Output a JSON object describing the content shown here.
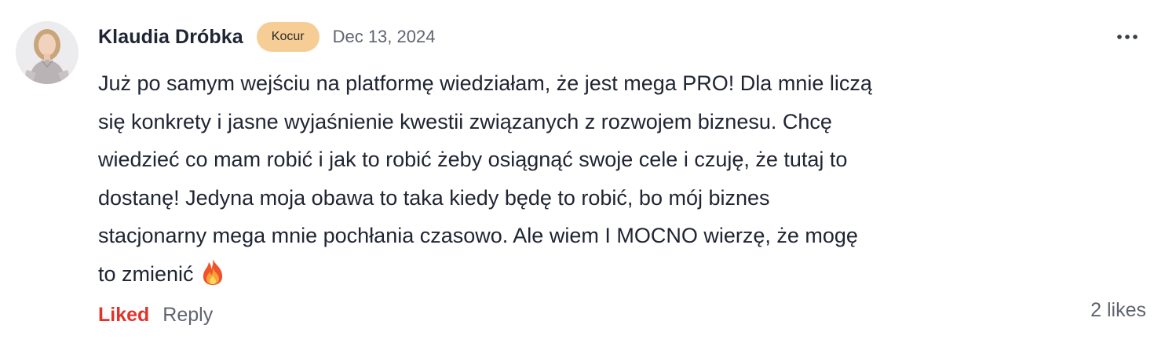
{
  "comment": {
    "author": "Klaudia Dróbka",
    "badge": "Kocur",
    "date": "Dec 13, 2024",
    "body_lines": [
      "Już po samym wejściu na platformę wiedziałam, że jest mega PRO! Dla mnie liczą",
      "się konkrety i jasne wyjaśnienie kwestii związanych z rozwojem biznesu. Chcę",
      "wiedzieć co mam robić i jak to robić żeby osiągnąć swoje cele i czuję, że tutaj to",
      "dostanę! Jedyna moja obawa to taka kiedy będę to robić, bo mój biznes",
      "stacjonarny mega mnie pochłania czasowo. Ale wiem I MOCNO wierzę, że mogę",
      "to zmienić"
    ],
    "emoji": "fire-icon",
    "liked_label": "Liked",
    "reply_label": "Reply",
    "likes": "2 likes"
  },
  "colors": {
    "badge_bg": "#f6cd94",
    "liked": "#e0342a",
    "text": "#202533",
    "muted": "#5f6470"
  }
}
